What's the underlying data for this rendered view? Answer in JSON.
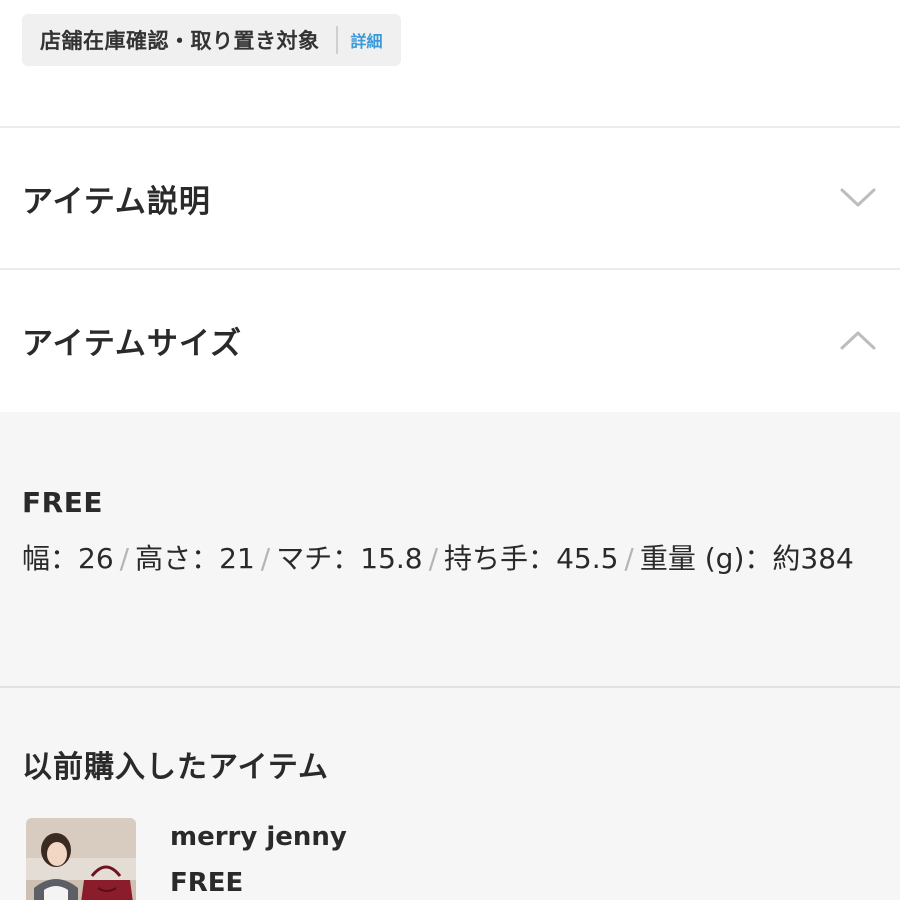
{
  "store_stock": {
    "label": "店舗在庫確認・取り置き対象",
    "link": "詳細"
  },
  "accordion": [
    {
      "title": "アイテム説明",
      "state": "collapsed",
      "icon": "chevron-down-icon"
    },
    {
      "title": "アイテムサイズ",
      "state": "expanded",
      "icon": "chevron-up-icon"
    }
  ],
  "item_size": {
    "size_name": "FREE",
    "measurements": [
      {
        "label": "幅",
        "value": "26"
      },
      {
        "label": "高さ",
        "value": "21"
      },
      {
        "label": "マチ",
        "value": "15.8"
      },
      {
        "label": "持ち手",
        "value": "45.5"
      },
      {
        "label": "重量 (g)",
        "value": "約384"
      }
    ],
    "separator": "/",
    "colon": "："
  },
  "purchase_history": {
    "title": "以前購入したアイテム",
    "items": [
      {
        "brand": "merry jenny",
        "size": "FREE"
      }
    ]
  },
  "colors": {
    "link_blue": "#3a9ad9",
    "panel_bg": "#f6f6f6",
    "separator": "#b5b5b5"
  }
}
